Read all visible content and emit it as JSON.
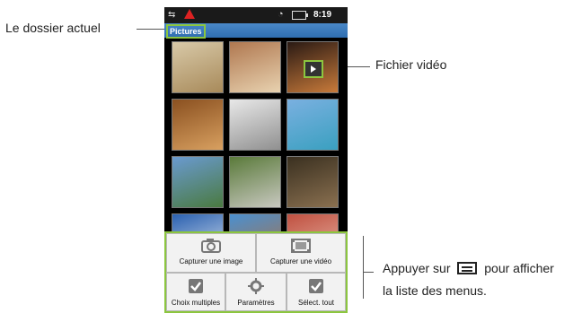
{
  "annotations": {
    "current_folder": "Le dossier actuel",
    "video_file": "Fichier vidéo",
    "menu_hint_before": "Appuyer sur",
    "menu_hint_after": "pour afficher",
    "menu_hint_line2": "la liste des menus."
  },
  "statusbar": {
    "time": "8:19"
  },
  "folder": {
    "title": "Pictures"
  },
  "gallery": {
    "thumbnails": [
      {
        "name": "thumb-bedroom",
        "colors": [
          "#d8c9a8",
          "#a88a5a"
        ]
      },
      {
        "name": "thumb-living-room",
        "colors": [
          "#b07850",
          "#e8d2b0"
        ]
      },
      {
        "name": "thumb-sunset-video",
        "colors": [
          "#2a1a14",
          "#c87a3a"
        ],
        "video": true
      },
      {
        "name": "thumb-library",
        "colors": [
          "#8a5020",
          "#d8a060"
        ]
      },
      {
        "name": "thumb-porch",
        "colors": [
          "#e8e8e8",
          "#909090"
        ]
      },
      {
        "name": "thumb-pool-house",
        "colors": [
          "#7ab0e0",
          "#3aa0c0"
        ]
      },
      {
        "name": "thumb-house-trees",
        "colors": [
          "#6a9ad0",
          "#4a7a40"
        ]
      },
      {
        "name": "thumb-garden-path",
        "colors": [
          "#5a7a3a",
          "#c8c8c0"
        ]
      },
      {
        "name": "thumb-forest-road",
        "colors": [
          "#3a3020",
          "#8a7050"
        ]
      },
      {
        "name": "thumb-blue-house",
        "colors": [
          "#2a60b0",
          "#dfe8f0"
        ]
      },
      {
        "name": "thumb-wood-cabin",
        "colors": [
          "#4a90d0",
          "#b07040"
        ]
      },
      {
        "name": "thumb-red-room",
        "colors": [
          "#c05040",
          "#e8b8a8"
        ]
      }
    ]
  },
  "menu": {
    "capture_image": "Capturer une image",
    "capture_video": "Capturer une vidéo",
    "multi_select": "Choix multiples",
    "settings": "Paramètres",
    "select_all": "Sélect. tout"
  },
  "icons": {
    "camera": "camera-icon",
    "film": "film-icon",
    "checkbox": "checkbox-icon",
    "gear": "gear-icon",
    "menu_key": "menu-key-icon"
  },
  "colors": {
    "highlight": "#8cc63f",
    "folder_bar": "#3a7cc0"
  }
}
